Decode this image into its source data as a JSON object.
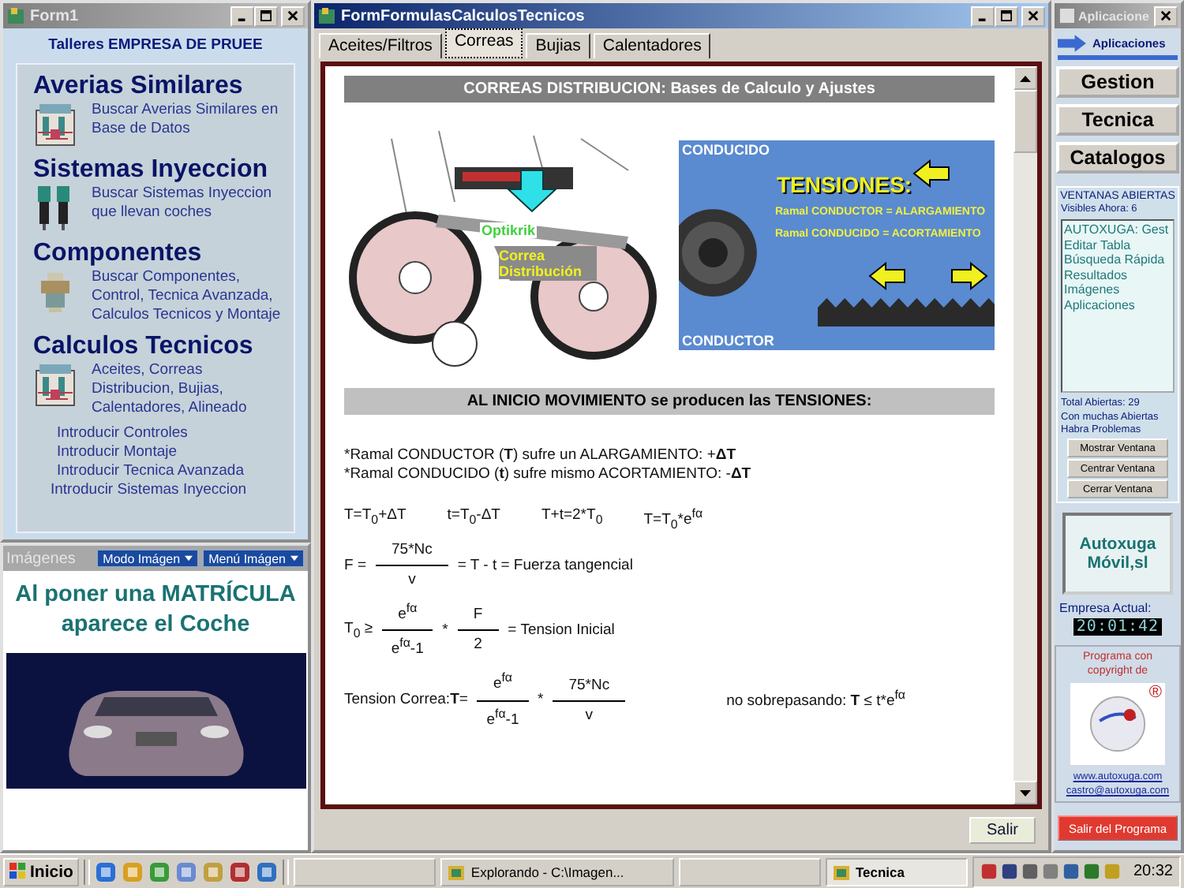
{
  "form1": {
    "title": "Form1",
    "company": "Talleres EMPRESA DE PRUEE",
    "sections": [
      {
        "kind": "chart",
        "heading": "Averias Similares",
        "description": "Buscar Averias Similares en Base de Datos"
      },
      {
        "kind": "injector",
        "heading": "Sistemas Inyeccion",
        "description": "Buscar Sistemas Inyeccion que llevan coches"
      },
      {
        "kind": "part",
        "heading": "Componentes",
        "description": "Buscar Componentes, Control, Tecnica Avanzada, Calculos Tecnicos y Montaje"
      },
      {
        "kind": "chart",
        "heading": "Calculos Tecnicos",
        "description": "Aceites, Correas Distribucion, Bujias, Calentadores, Alineado"
      }
    ],
    "links": [
      "Introducir Controles",
      "Introducir Montaje",
      "Introducir Tecnica Avanzada",
      "Introducir Sistemas Inyeccion"
    ]
  },
  "images": {
    "title": "Imágenes",
    "menus": [
      "Modo Imágen",
      "Menú Imágen"
    ],
    "caption": "Al poner una MATRÍCULA aparece el Coche"
  },
  "formulas": {
    "title": "FormFormulasCalculosTecnicos",
    "tabs": [
      {
        "label": "Aceites/Filtros",
        "selected": false
      },
      {
        "label": "Correas",
        "selected": true
      },
      {
        "label": "Bujias",
        "selected": false
      },
      {
        "label": "Calentadores",
        "selected": false
      }
    ],
    "heading": "CORREAS DISTRIBUCION: Bases de Calculo y Ajustes",
    "belt_labels": [
      "Optikrik",
      "Correa Distribución"
    ],
    "tensions": {
      "top_label": "CONDUCIDO",
      "heading": "TENSIONES:",
      "lines": [
        "Ramal CONDUCTOR = ALARGAMIENTO",
        "Ramal CONDUCIDO = ACORTAMIENTO"
      ],
      "bottom_label": "CONDUCTOR"
    },
    "subheading": "AL INICIO MOVIMIENTO se producen las TENSIONES:",
    "notes": [
      "*Ramal CONDUCTOR (**T**) sufre un ALARGAMIENTO: +**ΔT**",
      "*Ramal CONDUCIDO (**t**) sufre mismo ACORTAMIENTO: -**ΔT**"
    ],
    "equations": [
      "T=T$_{0}$+ΔT",
      "t=T$_{0}$-ΔT",
      "T+t=2*T$_{0}$",
      "T=T$_{0}$*e$^{fα}$"
    ],
    "fraction_rows": [
      {
        "parts": [
          {
            "kind": "text",
            "text": "F ="
          },
          {
            "kind": "fraction",
            "numerator": "75*Nc",
            "denominator": "v"
          },
          {
            "kind": "text",
            "text": "= T - t = Fuerza tangencial"
          }
        ]
      },
      {
        "parts": [
          {
            "kind": "text",
            "text": "T$_{0}$ ≥"
          },
          {
            "kind": "fraction",
            "numerator": "e$^{fα}$",
            "denominator": "e$^{fα}$-1"
          },
          {
            "kind": "text",
            "text": "*"
          },
          {
            "kind": "fraction",
            "numerator": "F",
            "denominator": "2"
          },
          {
            "kind": "text",
            "text": "= Tension Inicial"
          }
        ]
      },
      {
        "parts": [
          {
            "kind": "text",
            "text": "Tension Correa:**T**="
          },
          {
            "kind": "fraction",
            "numerator": "e$^{fα}$",
            "denominator": "e$^{fα}$-1"
          },
          {
            "kind": "text",
            "text": "*"
          },
          {
            "kind": "fraction",
            "numerator": "75*Nc",
            "denominator": "v"
          },
          {
            "kind": "note",
            "text": "no sobrepasando: **T** ≤ t*e$^{fα}$"
          }
        ]
      }
    ],
    "exit_button": "Salir"
  },
  "apps": {
    "title": "Aplicacione",
    "header": "Aplicaciones",
    "modules": [
      "Gestion",
      "Tecnica",
      "Catalogos"
    ],
    "open_windows": {
      "title": "VENTANAS ABIERTAS",
      "visible": "Visibles Ahora: 6",
      "items": [
        "AUTOXUGA: Gest",
        "Editar Tabla",
        "Búsqueda Rápida",
        "Resultados",
        "Imágenes",
        "Aplicaciones"
      ],
      "total": "Total Abiertas: 29",
      "warning": "Con muchas Abiertas Habra Problemas",
      "buttons": [
        "Mostrar Ventana",
        "Centrar Ventana",
        "Cerrar Ventana"
      ]
    },
    "company_logo": [
      "Autoxuga",
      "Móvil,sl"
    ],
    "company_label": "Empresa Actual:",
    "clock": "20:01:42",
    "copyright": "Programa con copyright de",
    "registered": "®",
    "links": [
      "www.autoxuga.com",
      "castro@autoxuga.com"
    ],
    "exit_button": "Salir del Programa"
  },
  "taskbar": {
    "start": "Inicio",
    "tasks": [
      {
        "selected": false
      },
      {
        "label": "Explorando - C:\\Imagen...",
        "selected": false
      },
      {
        "selected": false
      },
      {
        "label": "Tecnica",
        "selected": true
      }
    ],
    "time": "20:32"
  }
}
